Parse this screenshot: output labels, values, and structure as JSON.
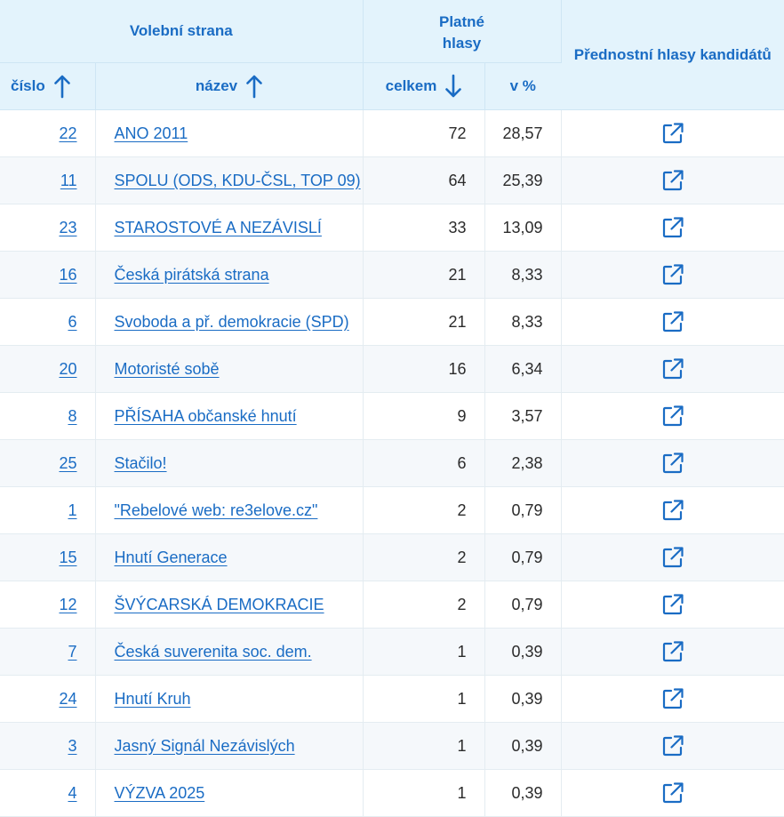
{
  "header": {
    "party_group": "Volební strana",
    "valid_votes_line1": "Platné",
    "valid_votes_line2": "hlasy",
    "preferential": "Přednostní hlasy kandidátů",
    "col_number": "číslo",
    "col_name": "název",
    "col_total": "celkem",
    "col_percent": "v %"
  },
  "icons": {
    "sort_number": "arrow-up-icon",
    "sort_name": "arrow-up-icon",
    "sort_total": "arrow-down-icon",
    "row_link": "external-link-icon"
  },
  "colors": {
    "accent": "#1a6cc4",
    "header_bg": "#e3f3fc",
    "stripe_bg": "#f5f8fb"
  },
  "rows": [
    {
      "number": "22",
      "name": "ANO 2011",
      "total": "72",
      "percent": "28,57"
    },
    {
      "number": "11",
      "name": "SPOLU (ODS, KDU-ČSL, TOP 09)",
      "total": "64",
      "percent": "25,39"
    },
    {
      "number": "23",
      "name": "STAROSTOVÉ A NEZÁVISLÍ",
      "total": "33",
      "percent": "13,09"
    },
    {
      "number": "16",
      "name": "Česká pirátská strana",
      "total": "21",
      "percent": "8,33"
    },
    {
      "number": "6",
      "name": "Svoboda a př. demokracie (SPD)",
      "total": "21",
      "percent": "8,33"
    },
    {
      "number": "20",
      "name": "Motoristé sobě",
      "total": "16",
      "percent": "6,34"
    },
    {
      "number": "8",
      "name": "PŘÍSAHA občanské hnutí",
      "total": "9",
      "percent": "3,57"
    },
    {
      "number": "25",
      "name": "Stačilo!",
      "total": "6",
      "percent": "2,38"
    },
    {
      "number": "1",
      "name": "\"Rebelové web: re3elove.cz\"",
      "total": "2",
      "percent": "0,79"
    },
    {
      "number": "15",
      "name": "Hnutí Generace",
      "total": "2",
      "percent": "0,79"
    },
    {
      "number": "12",
      "name": "ŠVÝCARSKÁ DEMOKRACIE",
      "total": "2",
      "percent": "0,79"
    },
    {
      "number": "7",
      "name": "Česká suverenita soc. dem.",
      "total": "1",
      "percent": "0,39"
    },
    {
      "number": "24",
      "name": "Hnutí Kruh",
      "total": "1",
      "percent": "0,39"
    },
    {
      "number": "3",
      "name": "Jasný Signál Nezávislých",
      "total": "1",
      "percent": "0,39"
    },
    {
      "number": "4",
      "name": "VÝZVA 2025",
      "total": "1",
      "percent": "0,39"
    }
  ]
}
